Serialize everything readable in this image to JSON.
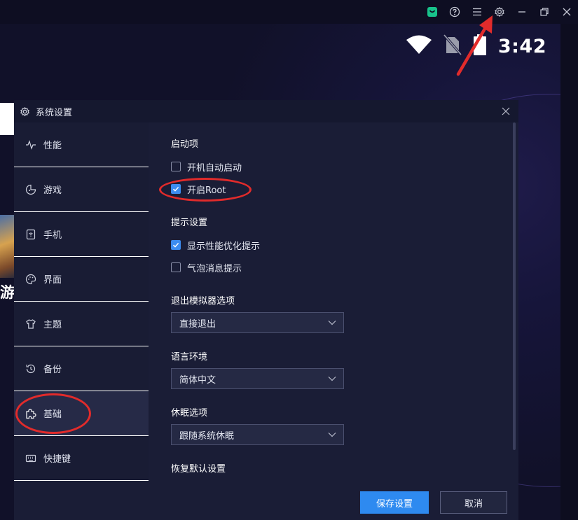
{
  "statusbar": {
    "time": "3:42"
  },
  "window_controls": {
    "icons": [
      "store-icon",
      "help-icon",
      "menu-icon",
      "settings-icon",
      "minimize-icon",
      "restore-icon",
      "close-icon"
    ]
  },
  "background": {
    "partial_text": "游戏"
  },
  "dialog": {
    "title": "系统设置",
    "sidebar": [
      {
        "label": "性能",
        "icon": "pulse-icon"
      },
      {
        "label": "游戏",
        "icon": "gamepad-icon"
      },
      {
        "label": "手机",
        "icon": "phone-icon"
      },
      {
        "label": "界面",
        "icon": "palette-icon"
      },
      {
        "label": "主题",
        "icon": "shirt-icon"
      },
      {
        "label": "备份",
        "icon": "history-icon"
      },
      {
        "label": "基础",
        "icon": "puzzle-icon",
        "active": true
      },
      {
        "label": "快捷键",
        "icon": "keyboard-icon"
      }
    ],
    "content": {
      "startup": {
        "title": "启动项",
        "options": [
          {
            "label": "开机自动启动",
            "checked": false
          },
          {
            "label": "开启Root",
            "checked": true
          }
        ]
      },
      "tips": {
        "title": "提示设置",
        "options": [
          {
            "label": "显示性能优化提示",
            "checked": true
          },
          {
            "label": "气泡消息提示",
            "checked": false
          }
        ]
      },
      "exit_option": {
        "title": "退出模拟器选项",
        "value": "直接退出"
      },
      "language": {
        "title": "语言环境",
        "value": "简体中文"
      },
      "sleep": {
        "title": "休眠选项",
        "value": "跟随系统休眠"
      },
      "restore": {
        "title": "恢复默认设置"
      }
    },
    "footer": {
      "save_label": "保存设置",
      "cancel_label": "取消"
    }
  },
  "colors": {
    "accent": "#2e8af0",
    "checkbox_on": "#3c8cf0",
    "annotation_red": "#e12b2b",
    "dialog_bg": "#1a1d36"
  }
}
